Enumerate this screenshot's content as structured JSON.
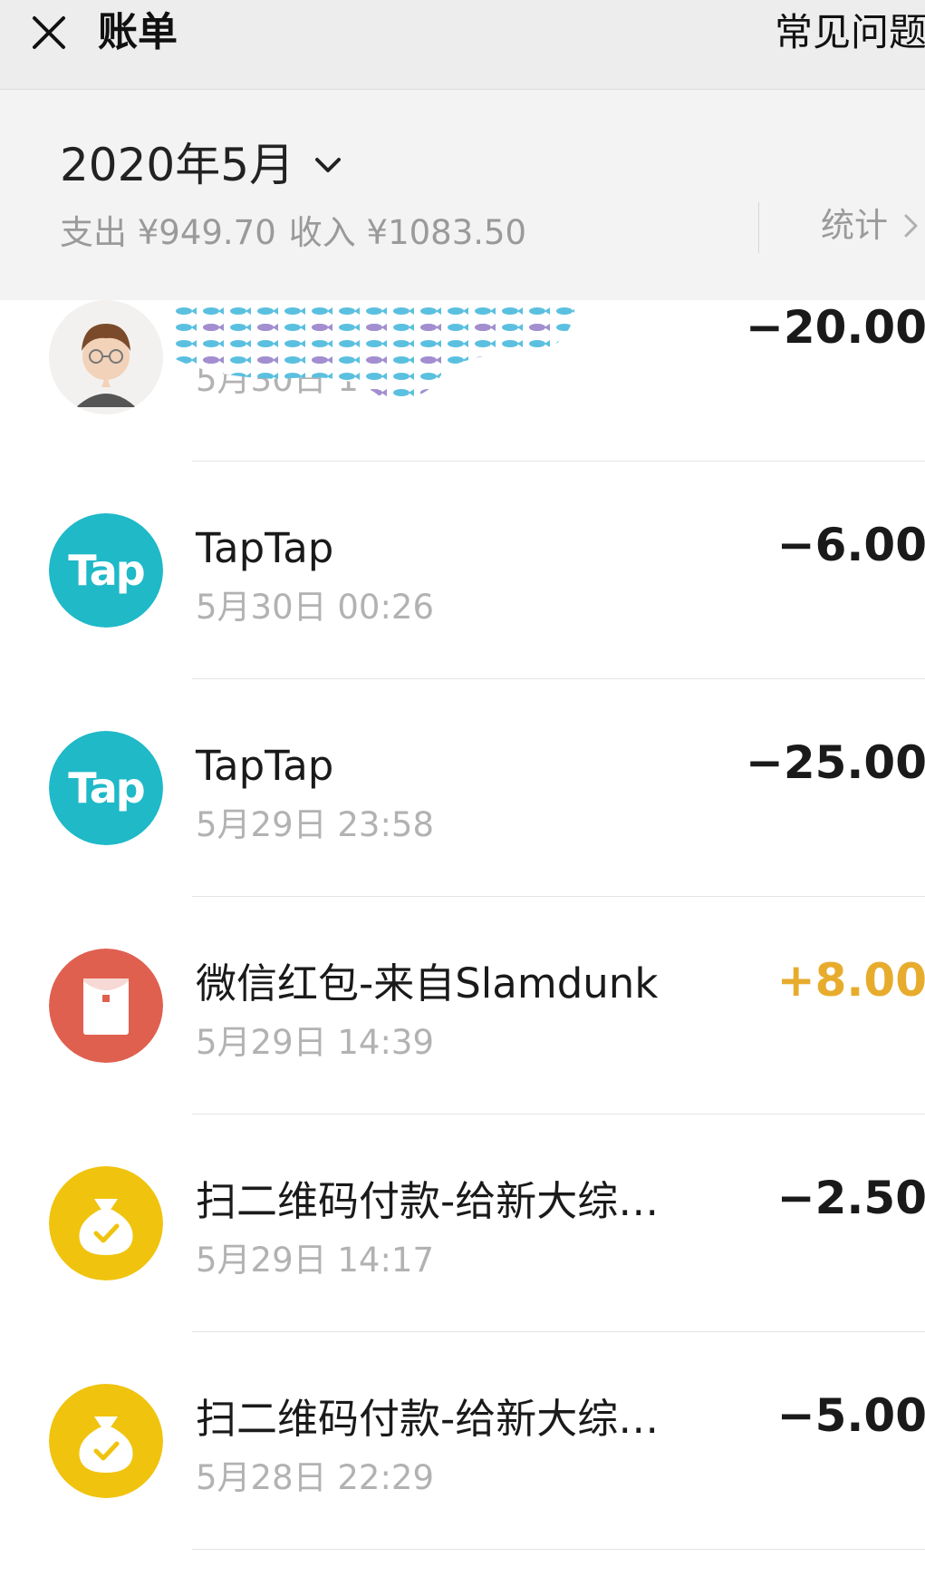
{
  "nav": {
    "title": "账单",
    "faq_label": "常见问题"
  },
  "summary": {
    "month": "2020年5月",
    "expense": "支出 ¥949.70",
    "income": "收入 ¥1083.50",
    "stats_label": "统计"
  },
  "transactions": [
    {
      "name": "",
      "time": "5月30日 1",
      "amount": "−20.00",
      "type": "expense",
      "icon": "user-avatar"
    },
    {
      "name": "TapTap",
      "time": "5月30日 00:26",
      "amount": "−6.00",
      "type": "expense",
      "icon": "taptap-logo",
      "icon_text": "Tap"
    },
    {
      "name": "TapTap",
      "time": "5月29日 23:58",
      "amount": "−25.00",
      "type": "expense",
      "icon": "taptap-logo",
      "icon_text": "Tap"
    },
    {
      "name": "微信红包-来自Slamdunk",
      "time": "5月29日 14:39",
      "amount": "+8.00",
      "type": "income",
      "icon": "red-packet-icon"
    },
    {
      "name": "扫二维码付款-给新大综…",
      "time": "5月29日 14:17",
      "amount": "−2.50",
      "type": "expense",
      "icon": "money-bag-icon"
    },
    {
      "name": "扫二维码付款-给新大综…",
      "time": "5月28日 22:29",
      "amount": "−5.00",
      "type": "expense",
      "icon": "money-bag-icon"
    }
  ],
  "colors": {
    "taptap": "#1fb9c8",
    "red_packet": "#e0604f",
    "money_bag": "#f0c30e",
    "income": "#e7ac2d"
  }
}
